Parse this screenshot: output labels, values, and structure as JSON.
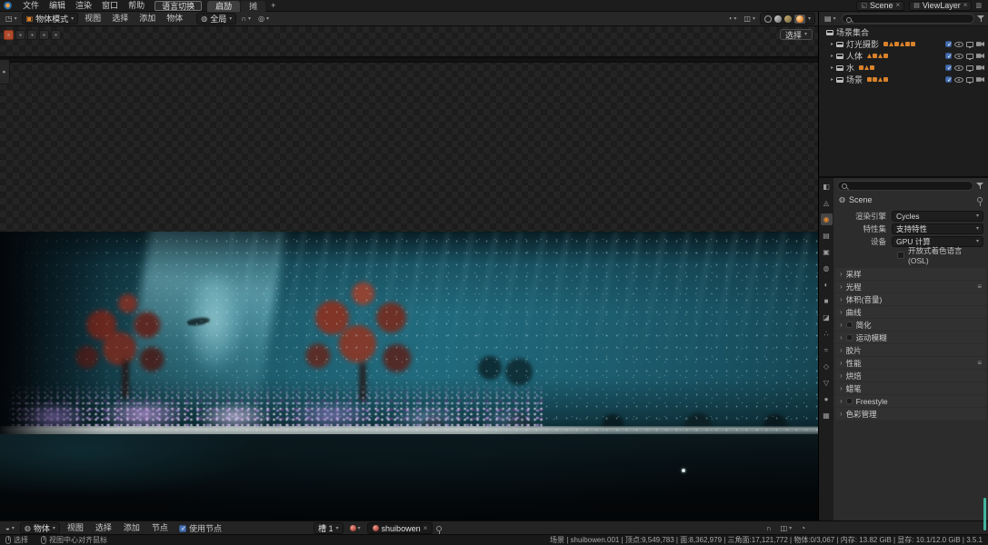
{
  "colors": {
    "accent_orange": "#e0862f",
    "checkbox_blue": "#4772b3",
    "water_teal": "#1f6375",
    "version_bar_teal": "#43b49e"
  },
  "topbar": {
    "menus": [
      "文件",
      "编辑",
      "渲染",
      "窗口",
      "帮助"
    ],
    "lang_toggle": "语言切换",
    "tabs": [
      "启劢",
      "摊"
    ],
    "add_tab": "+",
    "scene": "Scene",
    "view_layer": "ViewLayer"
  },
  "viewport": {
    "mode": "物体模式",
    "menus": [
      "视图",
      "选择",
      "添加",
      "物体"
    ],
    "orientation": "全局",
    "slot_select": "选择"
  },
  "outliner": {
    "root": "场景集合",
    "items": [
      {
        "label": "灯光摄影"
      },
      {
        "label": "人体"
      },
      {
        "label": "水"
      },
      {
        "label": "场景"
      }
    ]
  },
  "properties": {
    "context": "Scene",
    "fields": [
      {
        "label": "渲染引擎",
        "value": "Cycles"
      },
      {
        "label": "特性集",
        "value": "支持特性"
      },
      {
        "label": "设备",
        "value": "GPU 计算"
      }
    ],
    "osl": "开放式着色语言 (OSL)",
    "sections": [
      {
        "label": "采样"
      },
      {
        "label": "光程"
      },
      {
        "label": "体积(音量)"
      },
      {
        "label": "曲线"
      },
      {
        "label": "简化"
      },
      {
        "label": "运动模糊"
      },
      {
        "label": "胶片"
      },
      {
        "label": "性能"
      },
      {
        "label": "烘焙"
      },
      {
        "label": "蜡笔"
      },
      {
        "label": "Freestyle"
      },
      {
        "label": "色彩管理"
      }
    ]
  },
  "shader": {
    "type": "物体",
    "menus": [
      "视图",
      "选择",
      "添加",
      "节点"
    ],
    "use_nodes": "使用节点",
    "slot": "槽 1",
    "material": "shuibowen"
  },
  "status": {
    "hint1": "选择",
    "hint2": "视图中心对齐鼠标",
    "stats": "场景 | shuibowen.001 | 顶点:9,549,783 | 面:8,362,979 | 三角面:17,121,772 | 物体:0/3,067 | 内存: 13.82 GiB | 显存: 10.1/12.0 GiB | 3.5.1"
  },
  "icons": {
    "chevron-down-icon": "▾",
    "disclosure-icon": "▸",
    "section-chevron-icon": "›",
    "menu-icon": "≡",
    "magnet-icon": "∩",
    "proportional-icon": "◎",
    "viewport-editor-icon": "◳",
    "outliner-editor-icon": "▤",
    "properties-editor-icon": "◧",
    "shader-editor-icon": "◒",
    "cube-icon": "▣",
    "globe-icon": "◍",
    "screen-icon": "◱",
    "viewlayer-stack-icon": "▤",
    "copy-icon": "▥",
    "overlay-icon": "◫",
    "gizmo-icon": "◔",
    "tool-icon": "◬",
    "render-icon": "◉",
    "output-icon": "▤",
    "viewlayer-icon": "▣",
    "scene-icon": "◍",
    "world-icon": "◐",
    "object-icon": "■",
    "modifiers-icon": "◪",
    "particles-icon": "∴",
    "physics-icon": "≈",
    "constraints-icon": "◇",
    "data-icon": "▽",
    "material-icon": "●",
    "texture-icon": "▦",
    "close-icon": "×"
  }
}
